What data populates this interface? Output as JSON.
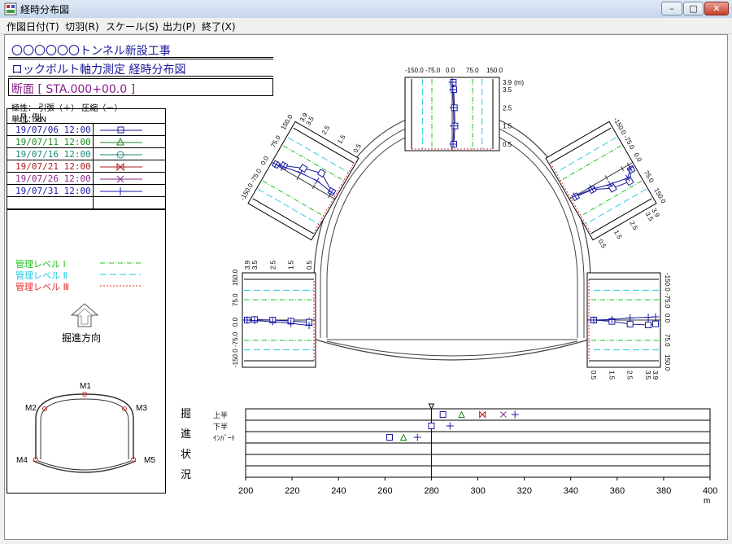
{
  "window": {
    "title": "経時分布図",
    "buttons": [
      "minimize",
      "maximize",
      "close"
    ]
  },
  "menu": [
    {
      "label": "作図日付(T)"
    },
    {
      "label": "切羽(R)"
    },
    {
      "label": "スケール(S)"
    },
    {
      "label": "出力(P)"
    },
    {
      "label": "終了(X)"
    }
  ],
  "header": {
    "project": "〇〇〇〇〇〇トンネル新設工事",
    "subtitle": "ロックボルト軸力測定 経時分布図",
    "section": "断面 [ STA.000+00.0 ]",
    "polarity": "極性： 引張（＋） 圧縮（－）",
    "unit": "単位：kN"
  },
  "legend": {
    "title": "凡 例",
    "dates": [
      {
        "label": "19/07/06 12:00",
        "color": "#1a1a9a",
        "marker": "square"
      },
      {
        "label": "19/07/11 12:00",
        "color": "#1a8a1a",
        "marker": "triangle"
      },
      {
        "label": "19/07/16 12:00",
        "color": "#1a8a7a",
        "marker": "circle"
      },
      {
        "label": "19/07/21 12:00",
        "color": "#b02020",
        "marker": "bowtie"
      },
      {
        "label": "19/07/26 12:00",
        "color": "#8a2a8a",
        "marker": "x"
      },
      {
        "label": "19/07/31 12:00",
        "color": "#1a1aaa",
        "marker": "plus"
      }
    ],
    "levels": [
      {
        "label": "管理レベル Ⅰ",
        "color": "#20c020",
        "style": "dashdot"
      },
      {
        "label": "管理レベル Ⅱ",
        "color": "#20c8e0",
        "style": "dashed"
      },
      {
        "label": "管理レベル Ⅲ",
        "color": "#e03030",
        "style": "dotted"
      }
    ],
    "direction": "掘進方向"
  },
  "key_map": {
    "points": [
      "M1",
      "M2",
      "M3",
      "M4",
      "M5"
    ]
  },
  "chart_data": [
    {
      "type": "line",
      "title": "",
      "point": "M1",
      "axis_label": "(m)",
      "depths": [
        0.5,
        1.5,
        2.5,
        3.5,
        3.9
      ],
      "ticks_force": [
        -150.0,
        -75.0,
        0.0,
        75.0,
        150.0
      ],
      "ticks_depth": [
        "3.9",
        "3.5",
        "2.5",
        "1.5",
        "0.5"
      ],
      "series": [
        {
          "name": "19/07/06 12:00",
          "values": [
            6,
            10,
            8,
            6,
            4
          ]
        },
        {
          "name": "19/07/31 12:00",
          "values": [
            3,
            6,
            5,
            2,
            0
          ]
        }
      ]
    },
    {
      "type": "line",
      "title": "",
      "point": "M2",
      "depths": [
        0.5,
        1.5,
        2.5,
        3.5,
        3.9
      ],
      "ticks_force": [
        -150.0,
        -75.0,
        0.0,
        75.0,
        150.0
      ],
      "ticks_depth": [
        "3.9",
        "3.5",
        "2.5",
        "1.5",
        "0.5"
      ],
      "series": [
        {
          "name": "19/07/06 12:00",
          "values": [
            18,
            58,
            40,
            12,
            2
          ]
        },
        {
          "name": "19/07/31 12:00",
          "values": [
            15,
            25,
            20,
            8,
            2
          ]
        }
      ]
    },
    {
      "type": "line",
      "title": "",
      "point": "M3",
      "depths": [
        0.5,
        1.5,
        2.5,
        3.5,
        3.9
      ],
      "ticks_force": [
        -150.0,
        -75.0,
        0.0,
        75.0,
        150.0
      ],
      "ticks_depth": [
        "3.9",
        "3.5",
        "2.5",
        "1.5",
        "0.5"
      ],
      "series": [
        {
          "name": "19/07/06 12:00",
          "values": [
            4,
            12,
            45,
            55,
            20
          ]
        },
        {
          "name": "19/07/31 12:00",
          "values": [
            0,
            10,
            28,
            40,
            14
          ]
        }
      ]
    },
    {
      "type": "line",
      "title": "",
      "point": "M4",
      "depths": [
        0.5,
        1.5,
        2.5,
        3.5,
        3.9
      ],
      "ticks_force": [
        -150.0,
        -75.0,
        0.0,
        75.0,
        150.0
      ],
      "ticks_depth": [
        "3.9",
        "3.5",
        "2.5",
        "1.5",
        "0.5"
      ],
      "series": [
        {
          "name": "19/07/06 12:00",
          "values": [
            -8,
            -4,
            0,
            2,
            0
          ]
        },
        {
          "name": "19/07/31 12:00",
          "values": [
            -20,
            -12,
            -6,
            -2,
            0
          ]
        }
      ]
    },
    {
      "type": "line",
      "title": "",
      "point": "M5",
      "depths": [
        0.5,
        1.5,
        2.5,
        3.5,
        3.9
      ],
      "ticks_force": [
        -150.0,
        -75.0,
        0.0,
        75.0,
        150.0
      ],
      "ticks_depth": [
        "3.9",
        "3.5",
        "2.5",
        "1.5",
        "0.5"
      ],
      "series": [
        {
          "name": "19/07/06 12:00",
          "values": [
            0,
            5,
            15,
            18,
            14
          ]
        },
        {
          "name": "19/07/31 12:00",
          "values": [
            0,
            -2,
            -8,
            -10,
            -12
          ]
        }
      ]
    },
    {
      "type": "scatter",
      "title": "",
      "row_labels": [
        "上半",
        "下半",
        "ｲﾝﾊﾞｰﾄ"
      ],
      "side_label": [
        "掘",
        "進",
        "状",
        "況"
      ],
      "xlim": [
        200,
        400
      ],
      "xticks": [
        200,
        220,
        240,
        260,
        280,
        300,
        320,
        340,
        360,
        380,
        400
      ],
      "xunit": "m",
      "section_marker": 280,
      "points": [
        {
          "row": "上半",
          "x": 285,
          "series": "19/07/06 12:00"
        },
        {
          "row": "上半",
          "x": 293,
          "series": "19/07/11 12:00"
        },
        {
          "row": "上半",
          "x": 302,
          "series": "19/07/21 12:00"
        },
        {
          "row": "上半",
          "x": 311,
          "series": "19/07/26 12:00"
        },
        {
          "row": "上半",
          "x": 316,
          "series": "19/07/31 12:00"
        },
        {
          "row": "下半",
          "x": 280,
          "series": "19/07/06 12:00"
        },
        {
          "row": "下半",
          "x": 288,
          "series": "19/07/31 12:00"
        },
        {
          "row": "ｲﾝﾊﾞｰﾄ",
          "x": 262,
          "series": "19/07/06 12:00"
        },
        {
          "row": "ｲﾝﾊﾞｰﾄ",
          "x": 268,
          "series": "19/07/11 12:00"
        },
        {
          "row": "ｲﾝﾊﾞｰﾄ",
          "x": 274,
          "series": "19/07/31 12:00"
        }
      ]
    }
  ]
}
